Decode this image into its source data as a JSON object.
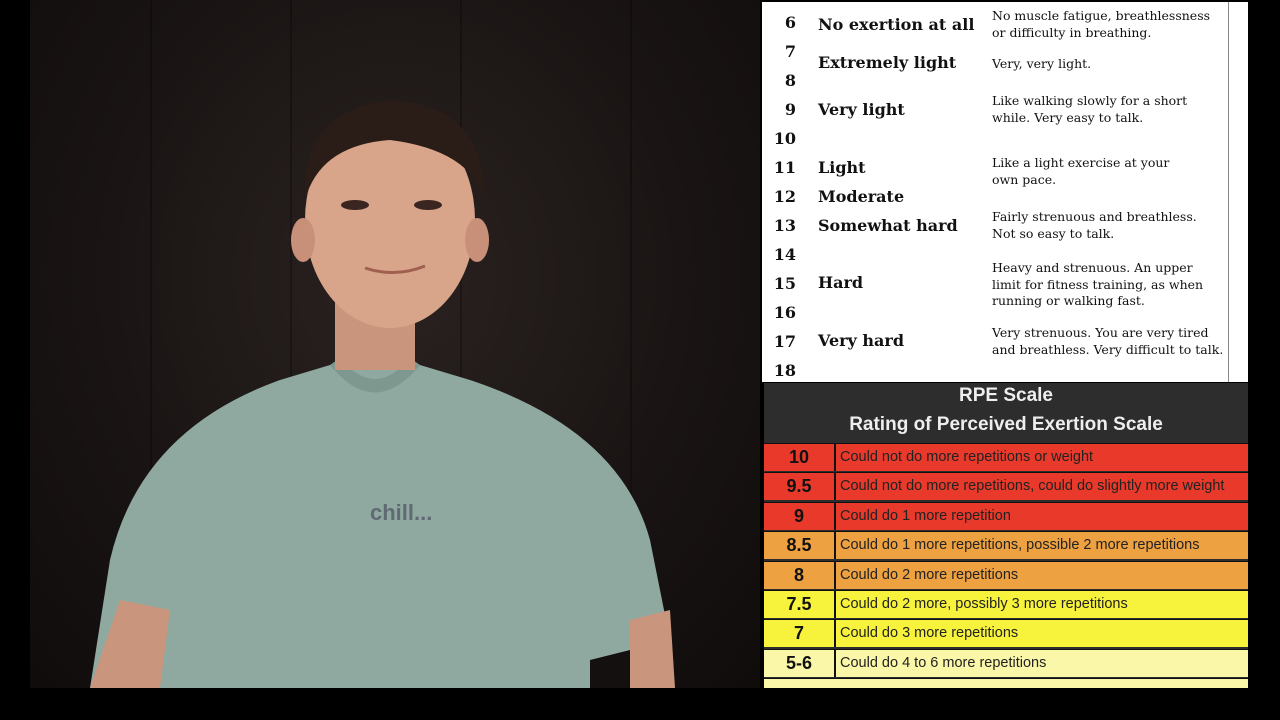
{
  "video": {
    "shirt_text": "chill..."
  },
  "borg": {
    "numbers": [
      "6",
      "7",
      "8",
      "9",
      "10",
      "11",
      "12",
      "13",
      "14",
      "15",
      "16",
      "17",
      "18"
    ],
    "labels": [
      "No exertion at all",
      "Extremely light",
      "Very light",
      "Light",
      "Moderate",
      "Somewhat hard",
      "Hard",
      "Very hard"
    ],
    "descriptions": [
      [
        "No muscle fatigue, breathlessness",
        "or difficulty in breathing."
      ],
      [
        "Very, very light."
      ],
      [
        "Like walking slowly for a short",
        "while. Very easy to talk."
      ],
      [
        "Like a light exercise at your",
        "own pace."
      ],
      [
        "Fairly strenuous and breathless.",
        "Not so easy to talk."
      ],
      [
        "Heavy and strenuous. An upper",
        "limit for fitness training, as when",
        "running or walking fast."
      ],
      [
        "Very strenuous. You are very  tired",
        "and breathless. Very difficult to talk."
      ]
    ]
  },
  "rpe": {
    "title": "RPE Scale",
    "subtitle": "Rating of Perceived Exertion Scale",
    "colors": {
      "red": "#e8392a",
      "orange": "#eea140",
      "yellow": "#f7f33c",
      "light_yellow": "#fbf7a8"
    },
    "rows": [
      {
        "value": "10",
        "text": "Could not do more repetitions or weight",
        "color": "#e8392a"
      },
      {
        "value": "9.5",
        "text": "Could not do more repetitions, could do slightly more weight",
        "color": "#e8392a"
      },
      {
        "value": "9",
        "text": "Could do 1 more repetition",
        "color": "#e8392a"
      },
      {
        "value": "8.5",
        "text": "Could do 1 more repetitions, possible 2 more repetitions",
        "color": "#eea140"
      },
      {
        "value": "8",
        "text": "Could do 2 more repetitions",
        "color": "#eea140"
      },
      {
        "value": "7.5",
        "text": "Could do 2 more, possibly 3 more repetitions",
        "color": "#f7f33c"
      },
      {
        "value": "7",
        "text": "Could do 3 more repetitions",
        "color": "#f7f33c"
      },
      {
        "value": "5-6",
        "text": "Could do 4 to 6 more repetitions",
        "color": "#fbf7a8"
      }
    ]
  }
}
